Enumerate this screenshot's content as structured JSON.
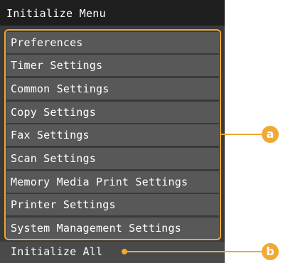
{
  "menu": {
    "title": "Initialize Menu",
    "items": [
      {
        "label": "Preferences"
      },
      {
        "label": "Timer Settings"
      },
      {
        "label": "Common Settings"
      },
      {
        "label": "Copy Settings"
      },
      {
        "label": "Fax Settings"
      },
      {
        "label": "Scan Settings"
      },
      {
        "label": "Memory Media Print Settings"
      },
      {
        "label": "Printer Settings"
      },
      {
        "label": "System Management Settings"
      }
    ],
    "initialize_all": "Initialize All"
  },
  "callouts": {
    "a": "a",
    "b": "b"
  },
  "colors": {
    "accent": "#f0a935",
    "title_bg": "#1e1e1e",
    "item_bg": "#585858",
    "panel_bg": "#3a3a3a",
    "text": "#ffffff"
  }
}
